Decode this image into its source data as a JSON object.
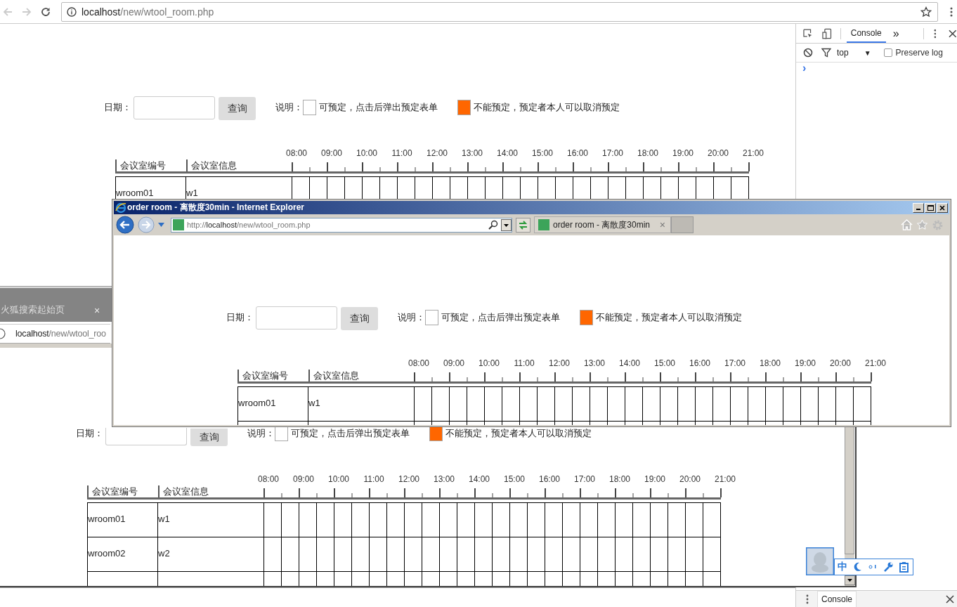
{
  "chrome": {
    "url_host": "localhost",
    "url_path": "/new/wtool_room.php"
  },
  "devtools": {
    "tabs": [
      {
        "label": "Console",
        "selected": true
      }
    ],
    "more": "»",
    "context": "top",
    "context_caret": "▼",
    "preserve_log": {
      "label": "Preserve log",
      "checked": false
    },
    "prompt": "›",
    "drawer_tab": {
      "label": "Console",
      "selected": true
    }
  },
  "chrome_page": {
    "date_label": "日期：",
    "query_button": "查询",
    "legend_label": "说明：",
    "legend": [
      {
        "color": "#ffffff",
        "text": "可预定，点击后弹出预定表单"
      },
      {
        "color": "#ff6600",
        "text": "不能预定，预定者本人可以取消预定"
      }
    ],
    "columns": [
      "会议室编号",
      "会议室信息"
    ],
    "hours": [
      "08:00",
      "09:00",
      "10:00",
      "11:00",
      "12:00",
      "13:00",
      "14:00",
      "15:00",
      "16:00",
      "17:00",
      "18:00",
      "19:00",
      "20:00",
      "21:00"
    ],
    "rows": [
      {
        "room": "wroom01",
        "info": "w1"
      }
    ]
  },
  "firefox_window": {
    "tab_title": "火狐搜索起始页",
    "tab_close": "×",
    "url_host": "localhost",
    "url_path": "/new/wtool_roo",
    "page": {
      "date_label": "日期：",
      "query_button": "查询",
      "legend_label": "说明：",
      "legend": [
        {
          "color": "#ffffff",
          "text": "可预定，点击后弹出预定表单"
        },
        {
          "color": "#ff6600",
          "text": "不能预定，预定者本人可以取消预定"
        }
      ],
      "columns": [
        "会议室编号",
        "会议室信息"
      ],
      "hours": [
        "08:00",
        "09:00",
        "10:00",
        "11:00",
        "12:00",
        "13:00",
        "14:00",
        "15:00",
        "16:00",
        "17:00",
        "18:00",
        "19:00",
        "20:00",
        "21:00"
      ],
      "rows": [
        {
          "room": "wroom01",
          "info": "w1"
        },
        {
          "room": "wroom02",
          "info": "w2"
        }
      ]
    }
  },
  "ie_window": {
    "title": "order room - 离散度30min - Internet Explorer",
    "url_prefix": "http://",
    "url_host": "localhost",
    "url_path": "/new/wtool_room.php",
    "tab_title": "order room - 离散度30min",
    "tab_close": "×",
    "page": {
      "date_label": "日期：",
      "query_button": "查询",
      "legend_label": "说明：",
      "legend": [
        {
          "color": "#ffffff",
          "text": "可预定，点击后弹出预定表单"
        },
        {
          "color": "#ff6600",
          "text": "不能预定，预定者本人可以取消预定"
        }
      ],
      "columns": [
        "会议室编号",
        "会议室信息"
      ],
      "hours": [
        "08:00",
        "09:00",
        "10:00",
        "11:00",
        "12:00",
        "13:00",
        "14:00",
        "15:00",
        "16:00",
        "17:00",
        "18:00",
        "19:00",
        "20:00",
        "21:00"
      ],
      "rows": [
        {
          "room": "wroom01",
          "info": "w1"
        }
      ]
    }
  },
  "ime": {
    "label": "中"
  }
}
